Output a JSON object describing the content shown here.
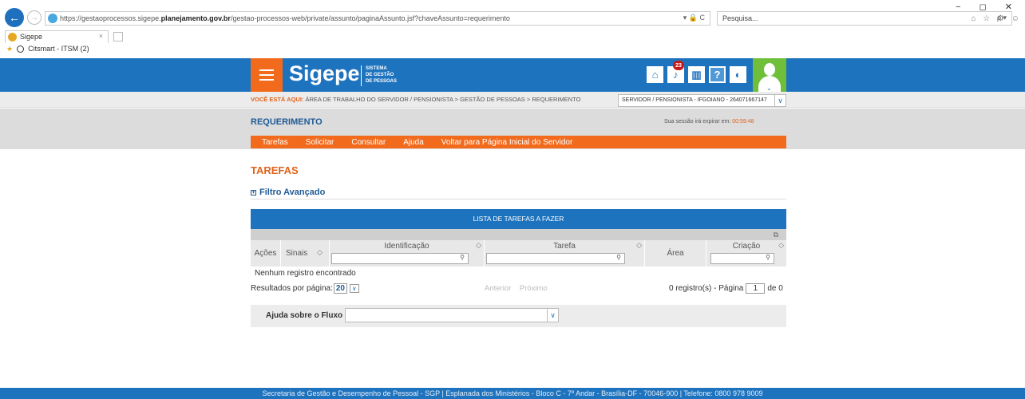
{
  "browser": {
    "url_prefix": "https://gestaoprocessos.sigepe.",
    "url_domain": "planejamento.gov.br",
    "url_path": "/gestao-processos-web/private/assunto/paginaAssunto.jsf?chaveAssunto=requerimento",
    "url_tools": "▾ 🔒 C",
    "search_placeholder": "Pesquisa...",
    "search_tools": "ρ ▾",
    "window_controls": "− ◻ ✕",
    "toolbar_icons": "⌂ ☆ ⚙ ☺",
    "back_glyph": "←",
    "forward_glyph": "→",
    "tab_title": "Sigepe",
    "tab_close": "×",
    "favorite_label": "Citsmart - ITSM (2)",
    "favorite_star": "★"
  },
  "header": {
    "brand": "Sigepe",
    "brand_sub_1": "SISTEMA",
    "brand_sub_2": "DE GESTÃO",
    "brand_sub_3": "DE PESSOAS",
    "notification_count": "23",
    "icons": [
      "home-icon",
      "bell-icon",
      "book-icon",
      "help-icon",
      "contrast-icon"
    ],
    "icon_glyphs": {
      "home": "⌂",
      "bell": "♪",
      "book": "▥",
      "help": "?",
      "contrast": "◐"
    },
    "avatar_chevron": "⌄"
  },
  "breadcrumb": {
    "lead": "VOCÊ ESTÁ AQUI:",
    "path": "ÁREA DE TRABALHO DO SERVIDOR / PENSIONISTA  >  GESTÃO DE PESSOAS  >  REQUERIMENTO"
  },
  "profile": {
    "selected": "SERVIDOR / PENSIONISTA - IFGOIANO - 264071667147",
    "arrow": "∨"
  },
  "page": {
    "title": "REQUERIMENTO",
    "session_text": "Sua sessão irá expirar em:",
    "session_timer": "00:59:48"
  },
  "menu": [
    "Tarefas",
    "Solicitar",
    "Consultar",
    "Ajuda",
    "Voltar para Página Inicial do Servidor"
  ],
  "content": {
    "section_title": "TAREFAS",
    "filter_toggle": "+",
    "filter_label": "Filtro Avançado"
  },
  "table": {
    "title": "LISTA DE TAREFAS A FAZER",
    "tool_icon": "⧉",
    "columns": {
      "acoes": "Ações",
      "sinais": "Sinais",
      "identificacao": "Identificação",
      "tarefa": "Tarefa",
      "area": "Área",
      "criacao": "Criação"
    },
    "sort_glyph": "◇",
    "search_glyph": "⚲",
    "empty_message": "Nenhum registro encontrado"
  },
  "pagination": {
    "per_page_label": "Resultados por página:",
    "per_page_value": "20",
    "arrow": "∨",
    "previous": "Anterior",
    "next": "Próximo",
    "count_prefix": "0 registro(s) - Página",
    "current_page": "1",
    "count_suffix": "de 0"
  },
  "help": {
    "label": "Ajuda sobre o Fluxo",
    "arrow": "∨"
  },
  "footer": {
    "text": "Secretaria de Gestão e Desempenho de Pessoal - SGP | Esplanada dos Ministérios - Bloco C - 7º Andar - Brasília-DF - 70046-900 | Telefone: 0800 978 9009"
  }
}
